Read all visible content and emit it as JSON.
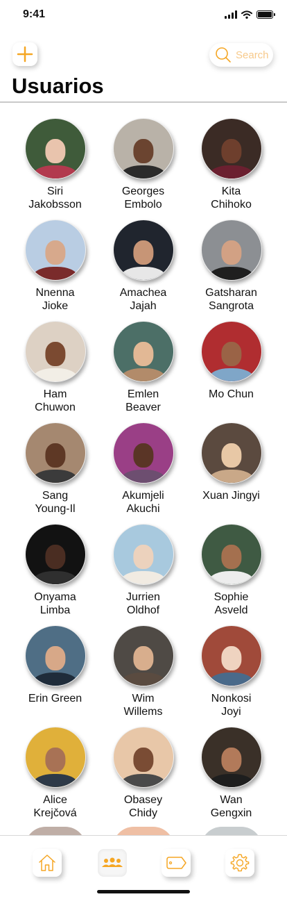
{
  "status_bar": {
    "time": "9:41"
  },
  "header": {
    "add_icon": "plus-icon",
    "search_placeholder": "Search",
    "title": "Usuarios"
  },
  "colors": {
    "accent": "#f5a623",
    "accent_light": "#f7c98a"
  },
  "users": [
    {
      "name": "Siri\nJakobsson",
      "skin": "#e9c4ad",
      "bg": "#3f5b3a",
      "shirt": "#b23a4e"
    },
    {
      "name": "Georges\nEmbolo",
      "skin": "#6b4430",
      "bg": "#b9b2a8",
      "shirt": "#2b2b2b"
    },
    {
      "name": "Kita\nChihoko",
      "skin": "#6e3f2d",
      "bg": "#3b2b25",
      "shirt": "#6b2030"
    },
    {
      "name": "Nnenna\nJioke",
      "skin": "#d7a98c",
      "bg": "#b9cde3",
      "shirt": "#7a2b2b"
    },
    {
      "name": "Amachea\nJajah",
      "skin": "#c79576",
      "bg": "#20252e",
      "shirt": "#e7e7e7"
    },
    {
      "name": "Gatsharan\nSangrota",
      "skin": "#d2a184",
      "bg": "#8c8f93",
      "shirt": "#1f1f1f"
    },
    {
      "name": "Ham\nChuwon",
      "skin": "#7b4a31",
      "bg": "#ddd1c4",
      "shirt": "#f2eee6"
    },
    {
      "name": "Emlen\nBeaver",
      "skin": "#e2b895",
      "bg": "#4c6f67",
      "shirt": "#b28b6a"
    },
    {
      "name": "Mo Chun",
      "skin": "#9a6346",
      "bg": "#b02d30",
      "shirt": "#7fa6c8"
    },
    {
      "name": "Sang\nYoung-Il",
      "skin": "#5e3825",
      "bg": "#a58870",
      "shirt": "#3b3b3b"
    },
    {
      "name": "Akumjeli\nAkuchi",
      "skin": "#5a3526",
      "bg": "#9a3f86",
      "shirt": "#6d4e70"
    },
    {
      "name": "Xuan Jingyi",
      "skin": "#e8c8a6",
      "bg": "#5b4a3f",
      "shirt": "#c9a888"
    },
    {
      "name": "Onyama\nLimba",
      "skin": "#4a2d22",
      "bg": "#121212",
      "shirt": "#2f2f2f"
    },
    {
      "name": "Jurrien\nOldhof",
      "skin": "#ecd2bd",
      "bg": "#a8c9de",
      "shirt": "#f1ebe2"
    },
    {
      "name": "Sophie\nAsveld",
      "skin": "#a4704f",
      "bg": "#3f5a43",
      "shirt": "#ededed"
    },
    {
      "name": "Erin Green",
      "skin": "#d7a888",
      "bg": "#4f6e85",
      "shirt": "#1f2c3a"
    },
    {
      "name": "Wim\nWillems",
      "skin": "#d8ae8d",
      "bg": "#4f4a45",
      "shirt": "#5a4b40"
    },
    {
      "name": "Nonkosi\nJoyi",
      "skin": "#efd3c0",
      "bg": "#a04a3a",
      "shirt": "#4a6a8a"
    },
    {
      "name": "Alice\nKrejčová",
      "skin": "#a87255",
      "bg": "#e0b03a",
      "shirt": "#2e3a48"
    },
    {
      "name": "Obasey\nChidy",
      "skin": "#7a4c34",
      "bg": "#e8c7a8",
      "shirt": "#4a4a4a"
    },
    {
      "name": "Wan\nGengxin",
      "skin": "#b27a5a",
      "bg": "#3a3028",
      "shirt": "#1e1e1e"
    }
  ],
  "partial_row": [
    "#8a6b5c",
    "#e28a5a",
    "#9aa4a8"
  ],
  "tab_bar": {
    "tabs": [
      {
        "name": "home-icon",
        "active": false
      },
      {
        "name": "users-icon",
        "active": true
      },
      {
        "name": "tag-icon",
        "active": false
      },
      {
        "name": "settings-icon",
        "active": false
      }
    ]
  }
}
